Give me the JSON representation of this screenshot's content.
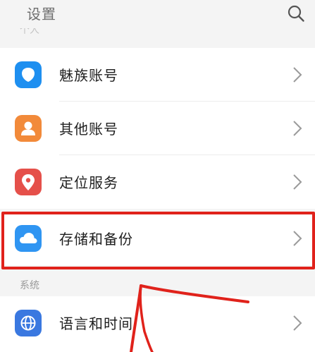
{
  "header": {
    "title": "设置",
    "search_icon": "search-icon"
  },
  "sections": {
    "personal_label": "个人",
    "system_label": "系统"
  },
  "rows": [
    {
      "label": "魅族账号",
      "icon": "meizu-account-icon",
      "color": "#1e8ff0"
    },
    {
      "label": "其他账号",
      "icon": "person-icon",
      "color": "#f28a3a"
    },
    {
      "label": "定位服务",
      "icon": "location-pin-icon",
      "color": "#e5504a"
    },
    {
      "label": "存储和备份",
      "icon": "cloud-icon",
      "color": "#2f95f2"
    },
    {
      "label": "语言和时间",
      "icon": "globe-icon",
      "color": "#3a78e0"
    }
  ],
  "annotation": {
    "highlight_color": "#e0221b",
    "highlighted_item": "存储和备份"
  }
}
